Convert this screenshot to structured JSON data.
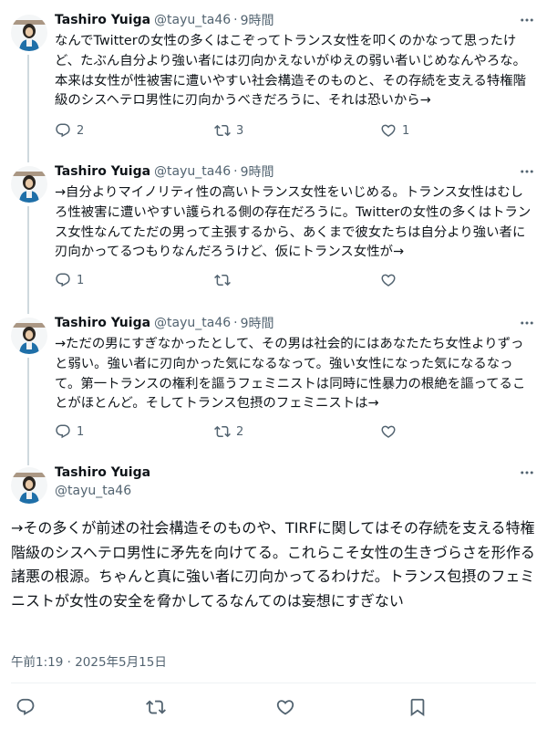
{
  "thread": [
    {
      "name": "Tashiro Yuiga",
      "handle": "@tayu_ta46",
      "separator": "·",
      "time": "9時間",
      "text": "なんでTwitterの女性の多くはこぞってトランス女性を叩くのかなって思ったけど、たぶん自分より強い者には刃向かえないがゆえの弱い者いじめなんやろな。本来は女性が性被害に遭いやすい社会構造そのものと、その存続を支える特権階級のシスヘテロ男性に刃向かうべきだろうに、それは恐いから→",
      "replies": "2",
      "retweets": "3",
      "likes": "1"
    },
    {
      "name": "Tashiro Yuiga",
      "handle": "@tayu_ta46",
      "separator": "·",
      "time": "9時間",
      "text": "→自分よりマイノリティ性の高いトランス女性をいじめる。トランス女性はむしろ性被害に遭いやすい護られる側の存在だろうに。Twitterの女性の多くはトランス女性なんてただの男って主張するから、あくまで彼女たちは自分より強い者に刃向かってるつもりなんだろうけど、仮にトランス女性が→",
      "replies": "1",
      "retweets": "",
      "likes": ""
    },
    {
      "name": "Tashiro Yuiga",
      "handle": "@tayu_ta46",
      "separator": "·",
      "time": "9時間",
      "text": "→ただの男にすぎなかったとして、その男は社会的にはあなたたち女性よりずっと弱い。強い者に刃向かった気になるなって。強い女性になった気になるなって。第一トランスの権利を謳うフェミニストは同時に性暴力の根絶を謳ってることがほとんど。そしてトランス包摂のフェミニストは→",
      "replies": "1",
      "retweets": "2",
      "likes": ""
    }
  ],
  "main": {
    "name": "Tashiro Yuiga",
    "handle": "@tayu_ta46",
    "text": "→その多くが前述の社会構造そのものや、TIRFに関してはその存続を支える特権階級のシスヘテロ男性に矛先を向けてる。これらこそ女性の生きづらさを形作る諸悪の根源。ちゃんと真に強い者に刃向かってるわけだ。トランス包摂のフェミニストが女性の安全を脅かしてるなんてのは妄想にすぎない",
    "timestamp": "午前1:19 · 2025年5月15日"
  },
  "icons": {
    "reply": "reply-bubble-icon",
    "retweet": "retweet-arrows-icon",
    "like": "heart-icon",
    "bookmark": "bookmark-icon",
    "more": "more-dots-icon"
  },
  "colors": {
    "text": "#0f1419",
    "secondary": "#536471",
    "thread_line": "#cfd9de"
  }
}
